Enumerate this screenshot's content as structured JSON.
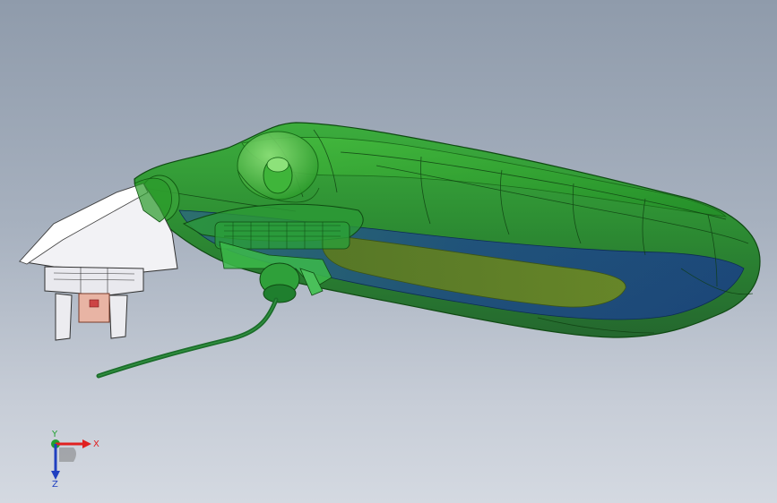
{
  "triad": {
    "x_label": "X",
    "y_label": "Y",
    "z_label": "Z"
  },
  "colors": {
    "background_top": "#8f9bab",
    "background_bottom": "#d4d9e1",
    "shell_green": "#1f8a1f",
    "shell_edge": "#0f4a12",
    "inner_blue": "#1e4a86",
    "connector_white": "#f2f2f5",
    "pink_part": "#e8b4a4",
    "cable_green": "#1b6d2a",
    "axis_x": "#e02020",
    "axis_y": "#20a030",
    "axis_z": "#2040c0"
  },
  "icons": {
    "triad": "coordinate-triad-icon"
  }
}
